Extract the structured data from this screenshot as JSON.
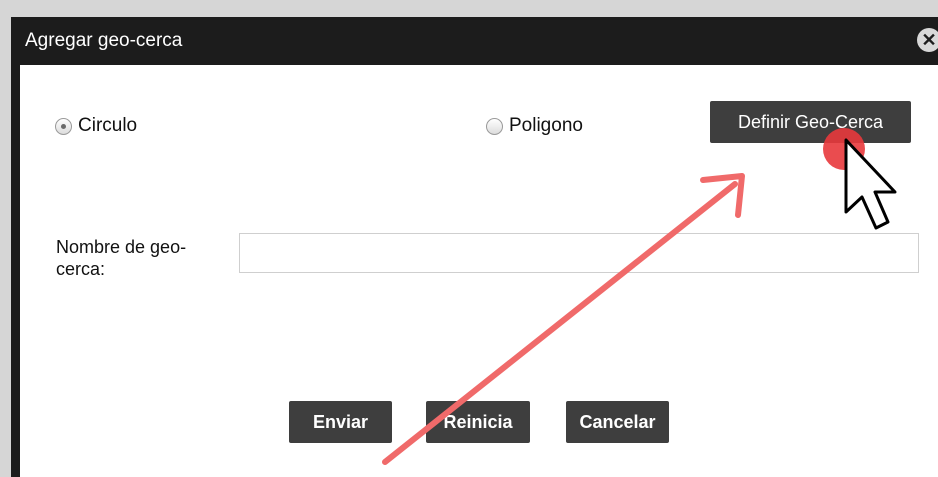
{
  "dialog": {
    "title": "Agregar geo-cerca",
    "close_icon": "close-circle-icon",
    "radios": [
      {
        "label": "Circulo",
        "checked": true
      },
      {
        "label": "Poligono",
        "checked": false
      }
    ],
    "define_button": "Definir Geo-Cerca",
    "name_field": {
      "label": "Nombre de geo-cerca:",
      "value": "",
      "placeholder": ""
    },
    "buttons": {
      "submit": "Enviar",
      "reset": "Reinicia",
      "cancel": "Cancelar"
    }
  },
  "annotation": {
    "arrow_color": "#f06a6a",
    "click_marker_color": "#e8383c"
  }
}
